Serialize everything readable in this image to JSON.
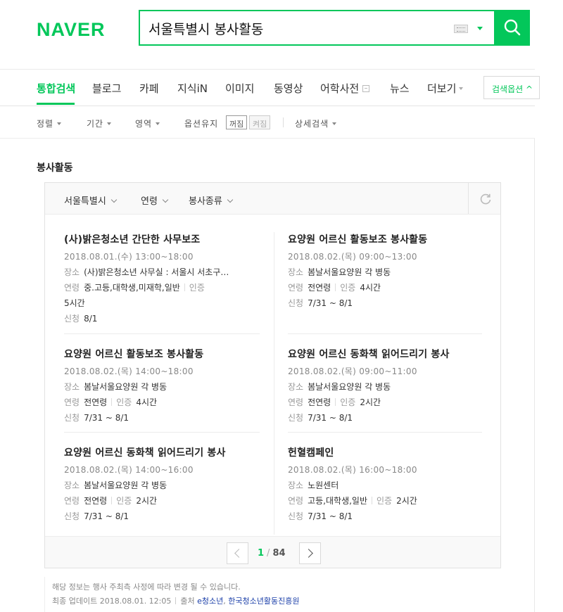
{
  "header": {
    "logo": "NAVER",
    "query": "서울특별시 봉사활동"
  },
  "tabs": [
    {
      "label": "통합검색",
      "active": true
    },
    {
      "label": "블로그"
    },
    {
      "label": "카페"
    },
    {
      "label": "지식iN"
    },
    {
      "label": "이미지"
    },
    {
      "label": "동영상"
    },
    {
      "label": "어학사전"
    },
    {
      "label": "뉴스"
    },
    {
      "label": "더보기"
    }
  ],
  "search_options_label": "검색옵션 ^",
  "filters": {
    "sort": "정렬",
    "period": "기간",
    "area": "영역",
    "keep_option": "옵션유지",
    "off": "꺼짐",
    "on": "켜짐",
    "detail": "상세검색"
  },
  "section": {
    "title": "봉사활동",
    "panel_filters": [
      "서울특별시",
      "연령",
      "봉사종류"
    ]
  },
  "labels": {
    "place": "장소",
    "age": "연령",
    "cert": "인증",
    "apply": "신청"
  },
  "cards": [
    {
      "title": "(사)밝은청소년 간단한 사무보조",
      "date": "2018.08.01.(수) 13:00~18:00",
      "place": "(사)밝은청소년 사무실 : 서울시 서초구…",
      "age": "중.고등,대학생,미재학,일반",
      "cert": "5시간",
      "apply": "8/1"
    },
    {
      "title": "요양원 어르신 활동보조 봉사활동",
      "date": "2018.08.02.(목) 09:00~13:00",
      "place": "봄날서울요양원 각 병동",
      "age": "전연령",
      "cert": "4시간",
      "apply": "7/31 ~ 8/1"
    },
    {
      "title": "요양원 어르신 활동보조 봉사활동",
      "date": "2018.08.02.(목) 14:00~18:00",
      "place": "봄날서울요양원 각 병동",
      "age": "전연령",
      "cert": "4시간",
      "apply": "7/31 ~ 8/1"
    },
    {
      "title": "요양원 어르신 동화책 읽어드리기 봉사",
      "date": "2018.08.02.(목) 09:00~11:00",
      "place": "봄날서울요양원 각 병동",
      "age": "전연령",
      "cert": "2시간",
      "apply": "7/31 ~ 8/1"
    },
    {
      "title": "요양원 어르신 동화책 읽어드리기 봉사",
      "date": "2018.08.02.(목) 14:00~16:00",
      "place": "봄날서울요양원 각 병동",
      "age": "전연령",
      "cert": "2시간",
      "apply": "7/31 ~ 8/1"
    },
    {
      "title": "헌혈캠페인",
      "date": "2018.08.02.(목) 16:00~18:00",
      "place": "노원센터",
      "age": "고등,대학생,일반",
      "cert": "2시간",
      "apply": "7/31 ~ 8/1"
    }
  ],
  "pagination": {
    "current": "1",
    "slash": "/",
    "total": "84"
  },
  "footer": {
    "notice": "해당 정보는 행사 주최측 사정에 따라 변경 될 수 있습니다.",
    "updated": "최종 업데이트 2018.08.01. 12:05",
    "source_label": "출처",
    "source1": "e청소년",
    "comma": ",",
    "source2": "한국청소년활동진흥원"
  },
  "colors": {
    "brand": "#03c75a",
    "link": "#1a3ea8"
  }
}
